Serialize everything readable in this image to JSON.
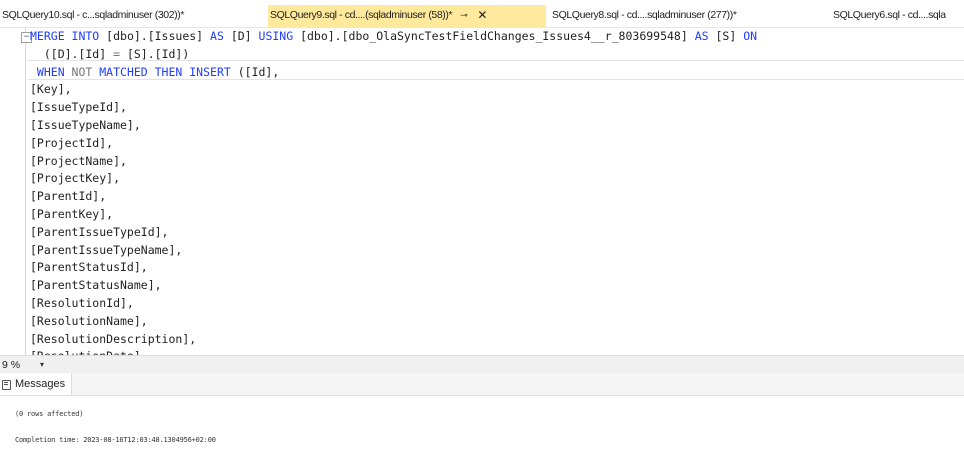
{
  "tabs": [
    {
      "label": "SQLQuery10.sql - c...sqladminuser (302))*",
      "active": false
    },
    {
      "label": "SQLQuery9.sql - cd....(sqladminuser (58))*",
      "active": true,
      "pin": "⊸",
      "close": "✕"
    },
    {
      "label": "SQLQuery8.sql - cd....sqladminuser (277))*",
      "active": false
    },
    {
      "label": "SQLQuery6.sql - cd....sqla",
      "active": false
    }
  ],
  "editor": {
    "collapse_marker": "−",
    "lines": [
      [
        {
          "t": "MERGE INTO ",
          "c": "kw"
        },
        {
          "t": "[dbo].[Issues] ",
          "c": ""
        },
        {
          "t": "AS ",
          "c": "kw"
        },
        {
          "t": "[D] ",
          "c": ""
        },
        {
          "t": "USING ",
          "c": "kw"
        },
        {
          "t": "[dbo].[dbo_OlaSyncTestFieldChanges_Issues4__r_803699548] ",
          "c": ""
        },
        {
          "t": "AS ",
          "c": "kw"
        },
        {
          "t": "[S] ",
          "c": ""
        },
        {
          "t": "ON",
          "c": "kw"
        }
      ],
      [
        {
          "t": "  ([D].[Id] ",
          "c": ""
        },
        {
          "t": "= ",
          "c": "gray"
        },
        {
          "t": "[S].[Id])",
          "c": ""
        }
      ],
      [
        {
          "t": " WHEN ",
          "c": "kw"
        },
        {
          "t": "NOT ",
          "c": "gray"
        },
        {
          "t": "MATCHED THEN INSERT ",
          "c": "kw"
        },
        {
          "t": "([Id],",
          "c": ""
        }
      ],
      [
        {
          "t": "[Key],",
          "c": ""
        }
      ],
      [
        {
          "t": "[IssueTypeId],",
          "c": ""
        }
      ],
      [
        {
          "t": "[IssueTypeName],",
          "c": ""
        }
      ],
      [
        {
          "t": "[ProjectId],",
          "c": ""
        }
      ],
      [
        {
          "t": "[ProjectName],",
          "c": ""
        }
      ],
      [
        {
          "t": "[ProjectKey],",
          "c": ""
        }
      ],
      [
        {
          "t": "[ParentId],",
          "c": ""
        }
      ],
      [
        {
          "t": "[ParentKey],",
          "c": ""
        }
      ],
      [
        {
          "t": "[ParentIssueTypeId],",
          "c": ""
        }
      ],
      [
        {
          "t": "[ParentIssueTypeName],",
          "c": ""
        }
      ],
      [
        {
          "t": "[ParentStatusId],",
          "c": ""
        }
      ],
      [
        {
          "t": "[ParentStatusName],",
          "c": ""
        }
      ],
      [
        {
          "t": "[ResolutionId],",
          "c": ""
        }
      ],
      [
        {
          "t": "[ResolutionName],",
          "c": ""
        }
      ],
      [
        {
          "t": "[ResolutionDescription],",
          "c": ""
        }
      ],
      [
        {
          "t": "[ResolutionDate]",
          "c": ""
        }
      ]
    ]
  },
  "zoom": {
    "value": "9 %",
    "dropdown": "▾"
  },
  "results": {
    "tab_label": "Messages",
    "messages": [
      "(0 rows affected)",
      "Completion time: 2023-08-16T12:03:48.1304956+02:00"
    ]
  },
  "colors": {
    "active_tab": "#ffe99c",
    "keyword": "#1f3dff",
    "operator": "#777777"
  }
}
